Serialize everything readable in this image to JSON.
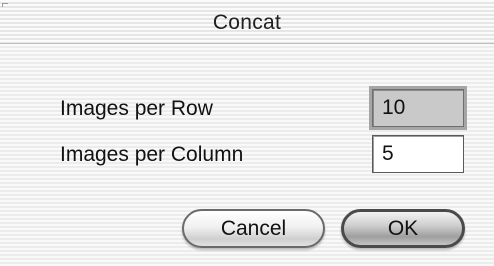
{
  "window": {
    "title": "Concat"
  },
  "form": {
    "rows_label": "Images per Row",
    "rows_value": "10",
    "columns_label": "Images per Column",
    "columns_value": "5"
  },
  "buttons": {
    "cancel_label": "Cancel",
    "ok_label": "OK"
  }
}
